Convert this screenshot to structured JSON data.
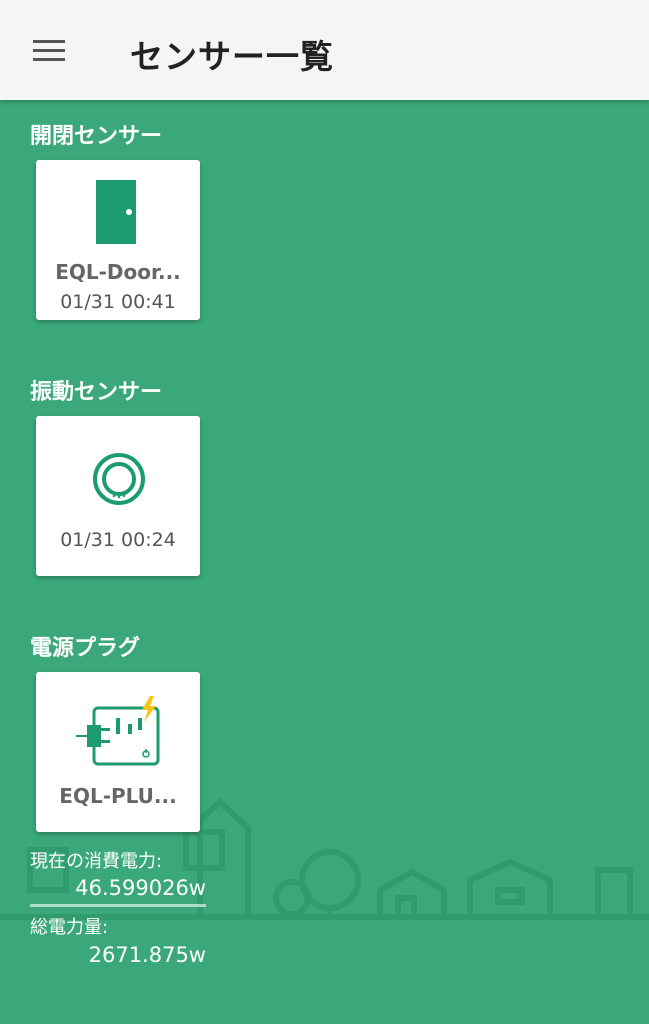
{
  "appbar": {
    "title": "センサー一覧",
    "menu_icon": "hamburger-menu-icon"
  },
  "sections": [
    {
      "title": "開閉センサー",
      "cards": [
        {
          "icon": "door-icon",
          "name": "EQL-Door...",
          "time": "01/31 00:41"
        }
      ]
    },
    {
      "title": "振動センサー",
      "cards": [
        {
          "icon": "vibration-sensor-icon",
          "name": "",
          "time": "01/31 00:24"
        }
      ]
    },
    {
      "title": "電源プラグ",
      "cards": [
        {
          "icon": "power-plug-icon",
          "name": "EQL-PLU..."
        }
      ]
    }
  ],
  "power": {
    "current_label": "現在の消費電力:",
    "current_value": "46.599026w",
    "total_label": "総電力量:",
    "total_value": "2671.875w"
  },
  "colors": {
    "background": "#3aa87a",
    "icon": "#1c9b6e",
    "bolt": "#f5c518",
    "appbar": "#f5f5f5"
  }
}
